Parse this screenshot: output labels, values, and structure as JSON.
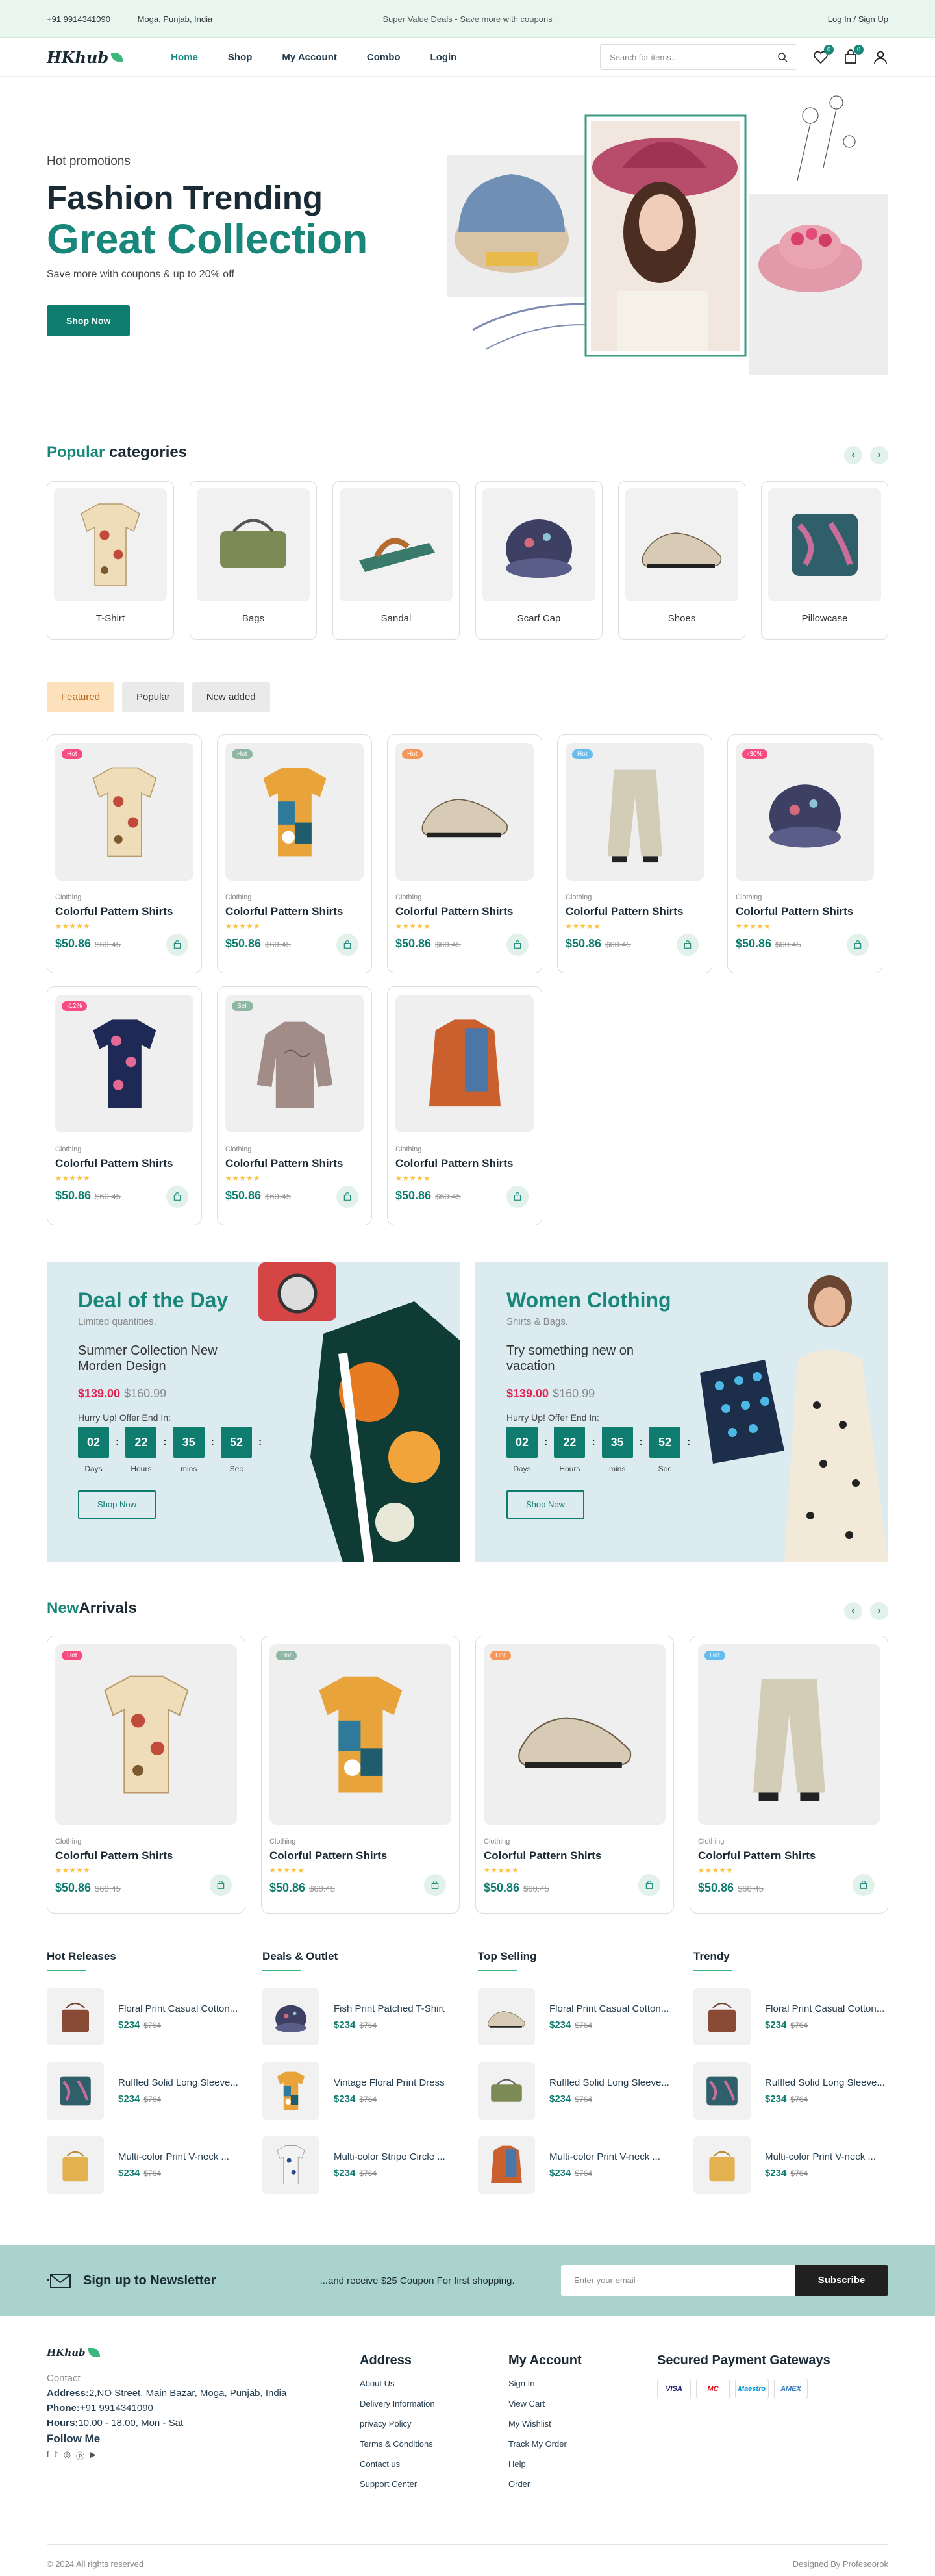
{
  "topbar": {
    "phone": "+91 9914341090",
    "location": "Moga, Punjab, India",
    "promo": "Super Value Deals - Save more with coupons",
    "auth": "Log In / Sign Up"
  },
  "header": {
    "logo": "HKhub",
    "nav": [
      {
        "label": "Home"
      },
      {
        "label": "Shop"
      },
      {
        "label": "My Account"
      },
      {
        "label": "Combo"
      },
      {
        "label": "Login"
      }
    ],
    "search_placeholder": "Search for items...",
    "wishlist_count": "0",
    "cart_count": "0"
  },
  "hero": {
    "kicker": "Hot promotions",
    "line1": "Fashion Trending",
    "line2": "Great Collection",
    "sub": "Save more with coupons & up to 20% off",
    "cta": "Shop Now"
  },
  "categories": {
    "title_hl": "Popular",
    "title_rest": " categories",
    "items": [
      {
        "label": "T-Shirt"
      },
      {
        "label": "Bags"
      },
      {
        "label": "Sandal"
      },
      {
        "label": "Scarf Cap"
      },
      {
        "label": "Shoes"
      },
      {
        "label": "Pillowcase"
      }
    ]
  },
  "tabs": [
    {
      "label": "Featured"
    },
    {
      "label": "Popular"
    },
    {
      "label": "New added"
    }
  ],
  "products": [
    {
      "badge": "Hot",
      "badge_color": "#f74b81",
      "category": "Clothing",
      "name": "Colorful Pattern Shirts",
      "stars": "★★★★★",
      "price": "$50.86",
      "old": "$60.45",
      "icon": "shirt-beige"
    },
    {
      "badge": "Hot",
      "badge_color": "#8fb5a3",
      "category": "Clothing",
      "name": "Colorful Pattern Shirts",
      "stars": "★★★★★",
      "price": "$50.86",
      "old": "$60.45",
      "icon": "shirt-colorful"
    },
    {
      "badge": "Hot",
      "badge_color": "#f59758",
      "category": "Clothing",
      "name": "Colorful Pattern Shirts",
      "stars": "★★★★★",
      "price": "$50.86",
      "old": "$60.45",
      "icon": "shoe"
    },
    {
      "badge": "Hot",
      "badge_color": "#67bcee",
      "category": "Clothing",
      "name": "Colorful Pattern Shirts",
      "stars": "★★★★★",
      "price": "$50.86",
      "old": "$60.45",
      "icon": "pants"
    },
    {
      "badge": "-30%",
      "badge_color": "#f74b81",
      "category": "Clothing",
      "name": "Colorful Pattern Shirts",
      "stars": "★★★★★",
      "price": "$50.86",
      "old": "$60.45",
      "icon": "cap"
    },
    {
      "badge": "-12%",
      "badge_color": "#f74b81",
      "category": "Clothing",
      "name": "Colorful Pattern Shirts",
      "stars": "★★★★★",
      "price": "$50.86",
      "old": "$60.45",
      "icon": "shirt-navy"
    },
    {
      "badge": "Sell",
      "badge_color": "#8fb5a3",
      "category": "Clothing",
      "name": "Colorful Pattern Shirts",
      "stars": "★★★★★",
      "price": "$50.86",
      "old": "$60.45",
      "icon": "blouse"
    },
    {
      "badge": "",
      "badge_color": "",
      "category": "Clothing",
      "name": "Colorful Pattern Shirts",
      "stars": "★★★★★",
      "price": "$50.86",
      "old": "$60.45",
      "icon": "jacket"
    }
  ],
  "deals": [
    {
      "title": "Deal of the Day",
      "sub": "Limited quantities.",
      "desc": "Summer Collection New Morden Design",
      "price": "$139.00",
      "old": "$160.99",
      "hurry": "Hurry Up! Offer End In:",
      "days": "02",
      "hours": "22",
      "mins": "35",
      "sec": "52",
      "l_days": "Days",
      "l_hours": "Hours",
      "l_mins": "mins",
      "l_sec": "Sec",
      "cta": "Shop Now"
    },
    {
      "title": "Women Clothing",
      "sub": "Shirts & Bags.",
      "desc": "Try something new on vacation",
      "price": "$139.00",
      "old": "$160.99",
      "hurry": "Hurry Up! Offer End In:",
      "days": "02",
      "hours": "22",
      "mins": "35",
      "sec": "52",
      "l_days": "Days",
      "l_hours": "Hours",
      "l_mins": "mins",
      "l_sec": "Sec",
      "cta": "Shop Now"
    }
  ],
  "new_arrivals": {
    "title_hl": "New",
    "title_rest": "Arrivals",
    "items": [
      {
        "badge": "Hot",
        "badge_color": "#f74b81",
        "category": "Clothing",
        "name": "Colorful Pattern Shirts",
        "stars": "★★★★★",
        "price": "$50.86",
        "old": "$60.45",
        "icon": "shirt-beige"
      },
      {
        "badge": "Hot",
        "badge_color": "#8fb5a3",
        "category": "Clothing",
        "name": "Colorful Pattern Shirts",
        "stars": "★★★★★",
        "price": "$50.86",
        "old": "$60.45",
        "icon": "shirt-colorful"
      },
      {
        "badge": "Hot",
        "badge_color": "#f59758",
        "category": "Clothing",
        "name": "Colorful Pattern Shirts",
        "stars": "★★★★★",
        "price": "$50.86",
        "old": "$60.45",
        "icon": "shoe"
      },
      {
        "badge": "Hot",
        "badge_color": "#67bcee",
        "category": "Clothing",
        "name": "Colorful Pattern Shirts",
        "stars": "★★★★★",
        "price": "$50.86",
        "old": "$60.45",
        "icon": "pants"
      }
    ]
  },
  "lists": [
    {
      "title": "Hot Releases",
      "items": [
        {
          "name": "Floral Print Casual Cotton...",
          "price": "$234",
          "old": "$764",
          "icon": "bag"
        },
        {
          "name": "Ruffled Solid Long Sleeve...",
          "price": "$234",
          "old": "$764",
          "icon": "pillow"
        },
        {
          "name": "Multi-color Print V-neck ...",
          "price": "$234",
          "old": "$764",
          "icon": "yellowbag"
        }
      ]
    },
    {
      "title": "Deals & Outlet",
      "items": [
        {
          "name": "Fish Print Patched T-Shirt",
          "price": "$234",
          "old": "$764",
          "icon": "cap"
        },
        {
          "name": "Vintage Floral Print Dress",
          "price": "$234",
          "old": "$764",
          "icon": "shirt-colorful"
        },
        {
          "name": "Multi-color Stripe Circle ...",
          "price": "$234",
          "old": "$764",
          "icon": "shirt-white"
        }
      ]
    },
    {
      "title": "Top Selling",
      "items": [
        {
          "name": "Floral Print Casual Cotton...",
          "price": "$234",
          "old": "$764",
          "icon": "shoe"
        },
        {
          "name": "Ruffled Solid Long Sleeve...",
          "price": "$234",
          "old": "$764",
          "icon": "greenbag"
        },
        {
          "name": "Multi-color Print V-neck ...",
          "price": "$234",
          "old": "$764",
          "icon": "jacket"
        }
      ]
    },
    {
      "title": "Trendy",
      "items": [
        {
          "name": "Floral Print Casual Cotton...",
          "price": "$234",
          "old": "$764",
          "icon": "bag"
        },
        {
          "name": "Ruffled Solid Long Sleeve...",
          "price": "$234",
          "old": "$764",
          "icon": "pillow"
        },
        {
          "name": "Multi-color Print V-neck ...",
          "price": "$234",
          "old": "$764",
          "icon": "yellowbag"
        }
      ]
    }
  ],
  "newsletter": {
    "title": "Sign up to Newsletter",
    "text": "...and receive $25 Coupon For first shopping.",
    "placeholder": "Enter your email",
    "button": "Subscribe"
  },
  "footer": {
    "contact_title": "Contact",
    "address_k": "Address:",
    "address_v": "2,NO Street, Main Bazar, Moga, Punjab, India",
    "phone_k": "Phone:",
    "phone_v": "+91 9914341090",
    "hours_k": "Hours:",
    "hours_v": "10.00 - 18.00, Mon - Sat",
    "follow": "Follow Me",
    "col1_title": "Address",
    "col1": [
      "About Us",
      "Delivery Information",
      "privacy Policy",
      "Terms & Conditions",
      "Contact us",
      "Support Center"
    ],
    "col2_title": "My Account",
    "col2": [
      "Sign In",
      "View Cart",
      "My Wishlist",
      "Track My Order",
      "Help",
      "Order"
    ],
    "pay_title": "Secured Payment Gateways",
    "pay": [
      "VISA",
      "MC",
      "Maestro",
      "AMEX"
    ],
    "copyright": "© 2024 All rights reserved",
    "credit": "Designed By Profeseorok"
  },
  "colors": {
    "accent": "#18877a",
    "button": "#0f7c70",
    "topbar": "#e9f5ef",
    "newsletter": "#a9d3cc",
    "deal_bg": "#dbebef"
  }
}
